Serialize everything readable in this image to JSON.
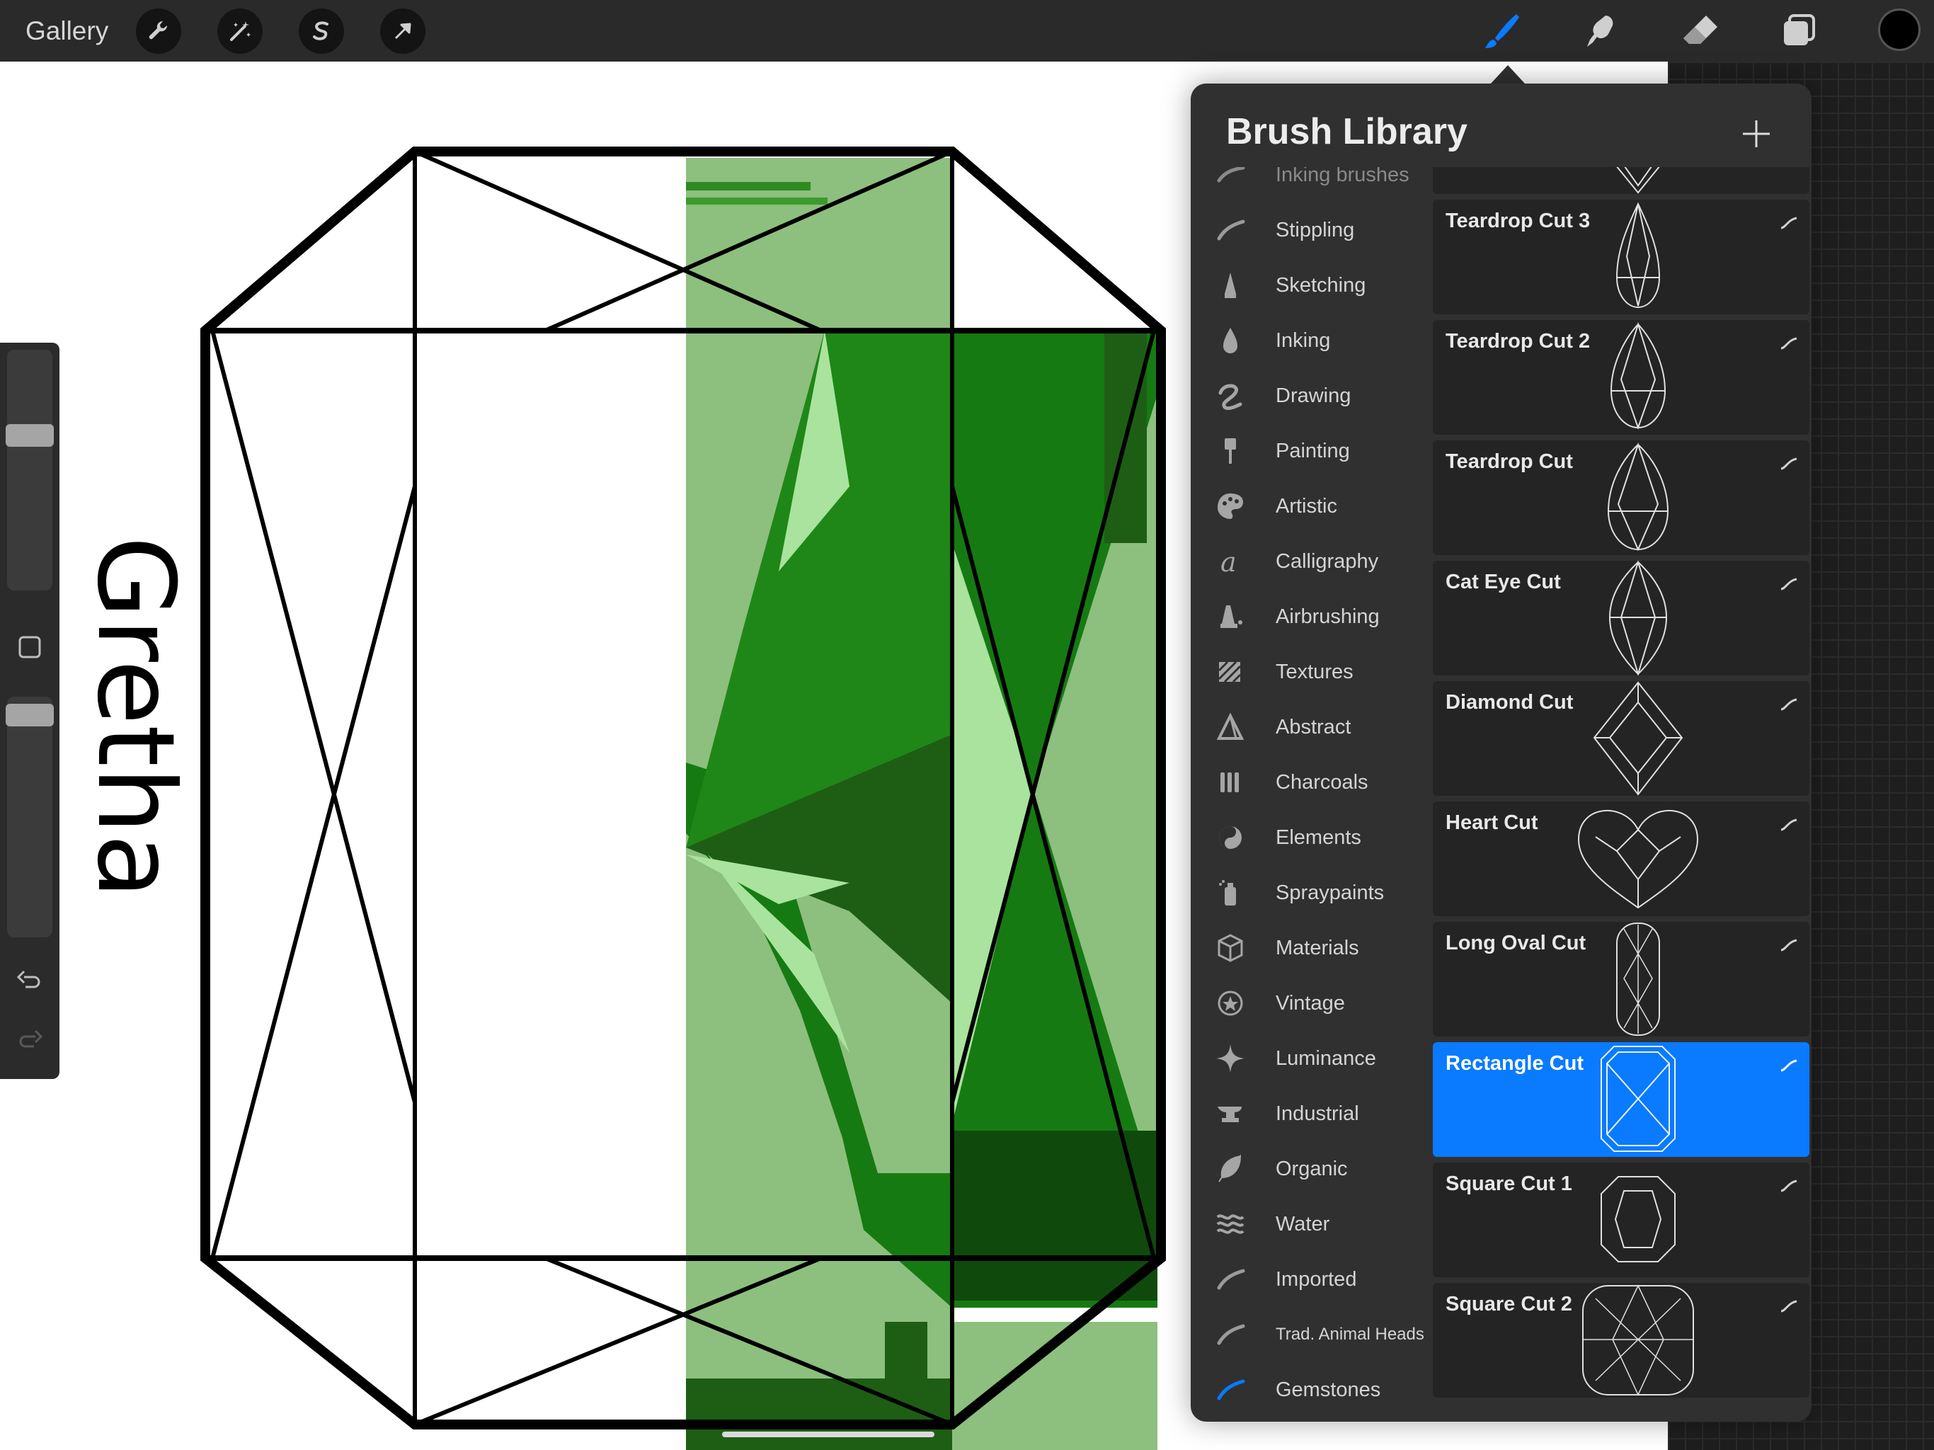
{
  "topbar": {
    "gallery_label": "Gallery",
    "left_tools": [
      "wrench-icon",
      "magic-wand-icon",
      "selection-icon",
      "transform-arrow-icon"
    ],
    "right_tools": [
      "brush-icon",
      "smudge-icon",
      "eraser-icon",
      "layers-icon"
    ],
    "active_tool": "brush-icon",
    "accent_color": "#0a7aff",
    "current_color": "#000000"
  },
  "sidebar": {
    "size_slider_level": 0.25,
    "opacity_slider_level": 0.03,
    "buttons": [
      "modify-button",
      "undo-icon",
      "redo-icon"
    ]
  },
  "canvas": {
    "lettering": "Gretha",
    "fill_colors": [
      "#8dbf7e",
      "#167a12",
      "#1d5e14",
      "#a9e39d"
    ]
  },
  "brush_library": {
    "title": "Brush Library",
    "add_icon": "plus-icon",
    "categories": [
      {
        "label": "Inking brushes",
        "icon": "brush-stroke-icon"
      },
      {
        "label": "Stippling",
        "icon": "stroke-icon"
      },
      {
        "label": "Sketching",
        "icon": "pencil-tip-icon"
      },
      {
        "label": "Inking",
        "icon": "ink-drop-icon"
      },
      {
        "label": "Drawing",
        "icon": "squiggle-icon"
      },
      {
        "label": "Painting",
        "icon": "paint-brush-icon"
      },
      {
        "label": "Artistic",
        "icon": "palette-icon"
      },
      {
        "label": "Calligraphy",
        "icon": "calligraphy-icon"
      },
      {
        "label": "Airbrushing",
        "icon": "airbrush-icon"
      },
      {
        "label": "Textures",
        "icon": "texture-icon"
      },
      {
        "label": "Abstract",
        "icon": "triangle-icon"
      },
      {
        "label": "Charcoals",
        "icon": "charcoal-icon"
      },
      {
        "label": "Elements",
        "icon": "yin-yang-icon"
      },
      {
        "label": "Spraypaints",
        "icon": "spray-can-icon"
      },
      {
        "label": "Materials",
        "icon": "cube-icon"
      },
      {
        "label": "Vintage",
        "icon": "star-badge-icon"
      },
      {
        "label": "Luminance",
        "icon": "sparkle-icon"
      },
      {
        "label": "Industrial",
        "icon": "anvil-icon"
      },
      {
        "label": "Organic",
        "icon": "leaf-icon"
      },
      {
        "label": "Water",
        "icon": "waves-icon"
      },
      {
        "label": "Imported",
        "icon": "stroke-icon"
      },
      {
        "label": "Trad. Animal Heads",
        "icon": "stroke-icon"
      },
      {
        "label": "Gemstones",
        "icon": "stroke-icon"
      }
    ],
    "selected_category": "Gemstones",
    "brushes": [
      {
        "name": "",
        "shape": "partial"
      },
      {
        "name": "Teardrop Cut 3",
        "shape": "teardrop"
      },
      {
        "name": "Teardrop Cut 2",
        "shape": "teardrop"
      },
      {
        "name": "Teardrop Cut",
        "shape": "teardrop"
      },
      {
        "name": "Cat Eye Cut",
        "shape": "marquise"
      },
      {
        "name": "Diamond Cut",
        "shape": "diamond"
      },
      {
        "name": "Heart Cut",
        "shape": "heart"
      },
      {
        "name": "Long Oval Cut",
        "shape": "long-oval"
      },
      {
        "name": "Rectangle Cut",
        "shape": "rectangle"
      },
      {
        "name": "Square Cut 1",
        "shape": "square"
      },
      {
        "name": "Square Cut 2",
        "shape": "square-rounded"
      }
    ],
    "selected_brush": "Rectangle Cut"
  }
}
